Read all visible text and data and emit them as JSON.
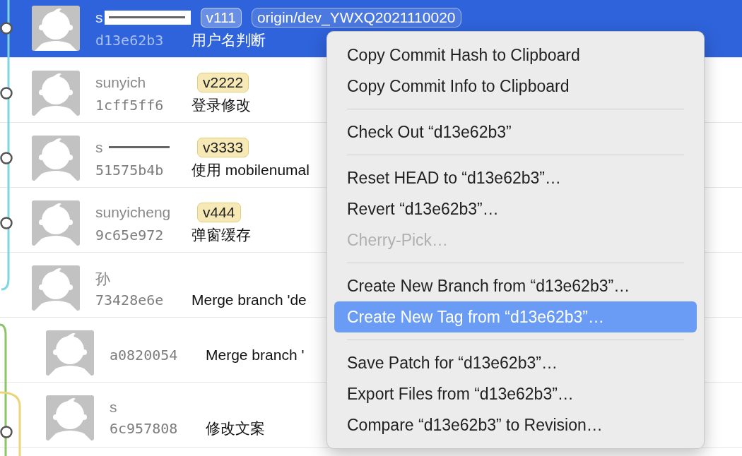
{
  "commits": [
    {
      "author": "s",
      "hash": "d13e62b3",
      "message": "用户名判断",
      "selected": true,
      "redacted": true,
      "tags": [
        {
          "label": "v111",
          "kind": "tag"
        },
        {
          "label": "origin/dev_YWXQ2021110020",
          "kind": "branch"
        }
      ]
    },
    {
      "author": "sunyich",
      "hash": "1cff5ff6",
      "message": "登录修改",
      "selected": false,
      "tags": [
        {
          "label": "v2222",
          "kind": "tag"
        }
      ]
    },
    {
      "author": "s",
      "hash": "51575b4b",
      "message": "使用 mobilenumal",
      "selected": false,
      "redacted": true,
      "tags": [
        {
          "label": "v3333",
          "kind": "tag"
        }
      ]
    },
    {
      "author": "sunyicheng",
      "hash": "9c65e972",
      "message": "弹窗缓存",
      "selected": false,
      "tags": [
        {
          "label": "v444",
          "kind": "tag"
        }
      ]
    },
    {
      "author": "孙",
      "hash": "73428e6e",
      "message": "Merge branch 'de",
      "selected": false,
      "children": [
        {
          "hash": "a0820054",
          "message": "Merge branch '",
          "selected": false
        },
        {
          "author": "s",
          "hash": "6c957808",
          "message": "修改文案",
          "selected": false
        }
      ]
    }
  ],
  "menu": {
    "items": [
      {
        "kind": "item",
        "label": "Copy Commit Hash to Clipboard",
        "disabled": false,
        "selected": false
      },
      {
        "kind": "item",
        "label": "Copy Commit Info to Clipboard",
        "disabled": false,
        "selected": false
      },
      {
        "kind": "separator"
      },
      {
        "kind": "item",
        "label": "Check Out “d13e62b3”",
        "disabled": false,
        "selected": false
      },
      {
        "kind": "separator"
      },
      {
        "kind": "item",
        "label": "Reset HEAD to “d13e62b3”…",
        "disabled": false,
        "selected": false
      },
      {
        "kind": "item",
        "label": "Revert “d13e62b3”…",
        "disabled": false,
        "selected": false
      },
      {
        "kind": "item",
        "label": "Cherry-Pick…",
        "disabled": true,
        "selected": false
      },
      {
        "kind": "separator"
      },
      {
        "kind": "item",
        "label": "Create New Branch from “d13e62b3”…",
        "disabled": false,
        "selected": false
      },
      {
        "kind": "item",
        "label": "Create New Tag from “d13e62b3”…",
        "disabled": false,
        "selected": true
      },
      {
        "kind": "separator"
      },
      {
        "kind": "item",
        "label": "Save Patch for “d13e62b3”…",
        "disabled": false,
        "selected": false
      },
      {
        "kind": "item",
        "label": "Export Files from “d13e62b3”…",
        "disabled": false,
        "selected": false
      },
      {
        "kind": "item",
        "label": "Compare “d13e62b3” to Revision…",
        "disabled": false,
        "selected": false
      }
    ]
  }
}
